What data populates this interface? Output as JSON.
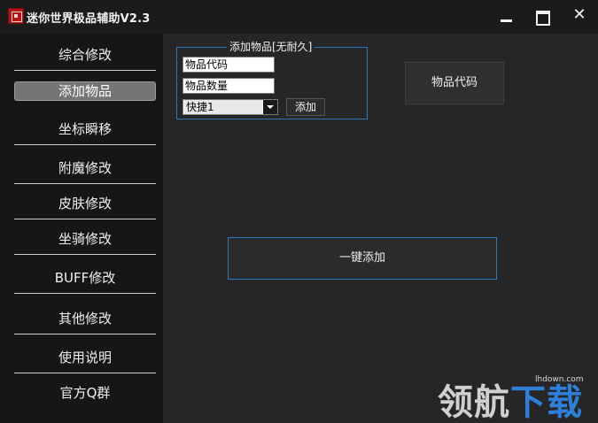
{
  "titlebar": {
    "title": "迷你世界极品辅助V2.3",
    "icons": [
      "app-logo",
      "minimize-icon",
      "maximize-icon",
      "close-icon"
    ],
    "close_glyph": "✕"
  },
  "sidebar": {
    "items": [
      {
        "label": "综合修改"
      },
      {
        "label": "添加物品",
        "active": true
      },
      {
        "label": "坐标瞬移"
      },
      {
        "label": "附魔修改"
      },
      {
        "label": "皮肤修改"
      },
      {
        "label": "坐骑修改"
      },
      {
        "label": "BUFF修改"
      },
      {
        "label": "其他修改"
      },
      {
        "label": "使用说明"
      },
      {
        "label": "官方Q群"
      }
    ]
  },
  "main": {
    "group_title": "添加物品[无耐久]",
    "item_code_value": "物品代码",
    "item_count_value": "物品数量",
    "slot_select_value": "快捷1",
    "add_label": "添加",
    "item_code_button": "物品代码",
    "one_click_add": "一键添加"
  },
  "watermark": {
    "url": "lhdown.com",
    "logo_part1": "领航",
    "logo_part2": "下载"
  },
  "colors": {
    "accent_border": "#2b77b8",
    "active_tab": "#757575",
    "logo_red": "#b0151a",
    "watermark_blue": "#2e7fd8"
  }
}
